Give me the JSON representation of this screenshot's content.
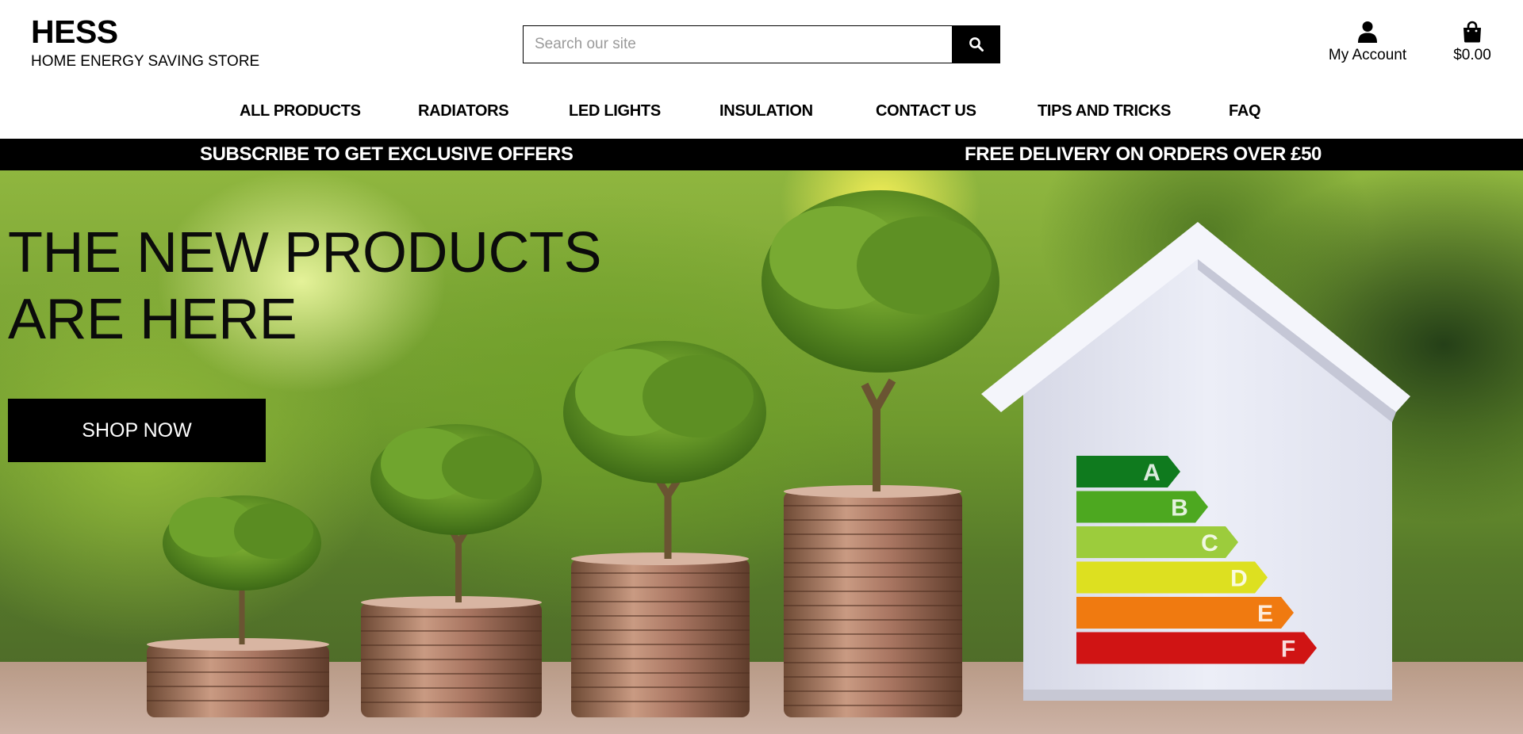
{
  "brand": {
    "title": "HESS",
    "subtitle": "HOME ENERGY SAVING STORE"
  },
  "search": {
    "placeholder": "Search our site",
    "value": "",
    "icon": "search-icon"
  },
  "account": {
    "label": "My Account",
    "icon": "user-icon"
  },
  "cart": {
    "total": "$0.00",
    "icon": "shopping-bag-icon"
  },
  "nav": {
    "items": [
      {
        "label": "ALL PRODUCTS"
      },
      {
        "label": "RADIATORS"
      },
      {
        "label": "LED LIGHTS"
      },
      {
        "label": "INSULATION"
      },
      {
        "label": "CONTACT US"
      },
      {
        "label": "TIPS AND TRICKS"
      },
      {
        "label": "FAQ"
      }
    ]
  },
  "promo": {
    "left": "SUBSCRIBE TO GET EXCLUSIVE OFFERS",
    "right": "FREE DELIVERY ON ORDERS OVER £50"
  },
  "hero": {
    "title": "THE NEW PRODUCTS ARE HERE",
    "cta_label": "SHOP NOW",
    "energy_labels": [
      "A",
      "B",
      "C",
      "D",
      "E",
      "F"
    ],
    "energy_colors": [
      "#0f7a1e",
      "#4da820",
      "#9ccc3c",
      "#dde020",
      "#f07a10",
      "#d01414"
    ]
  },
  "colors": {
    "background": "#ffffff",
    "bar": "#000000",
    "text": "#000000"
  }
}
